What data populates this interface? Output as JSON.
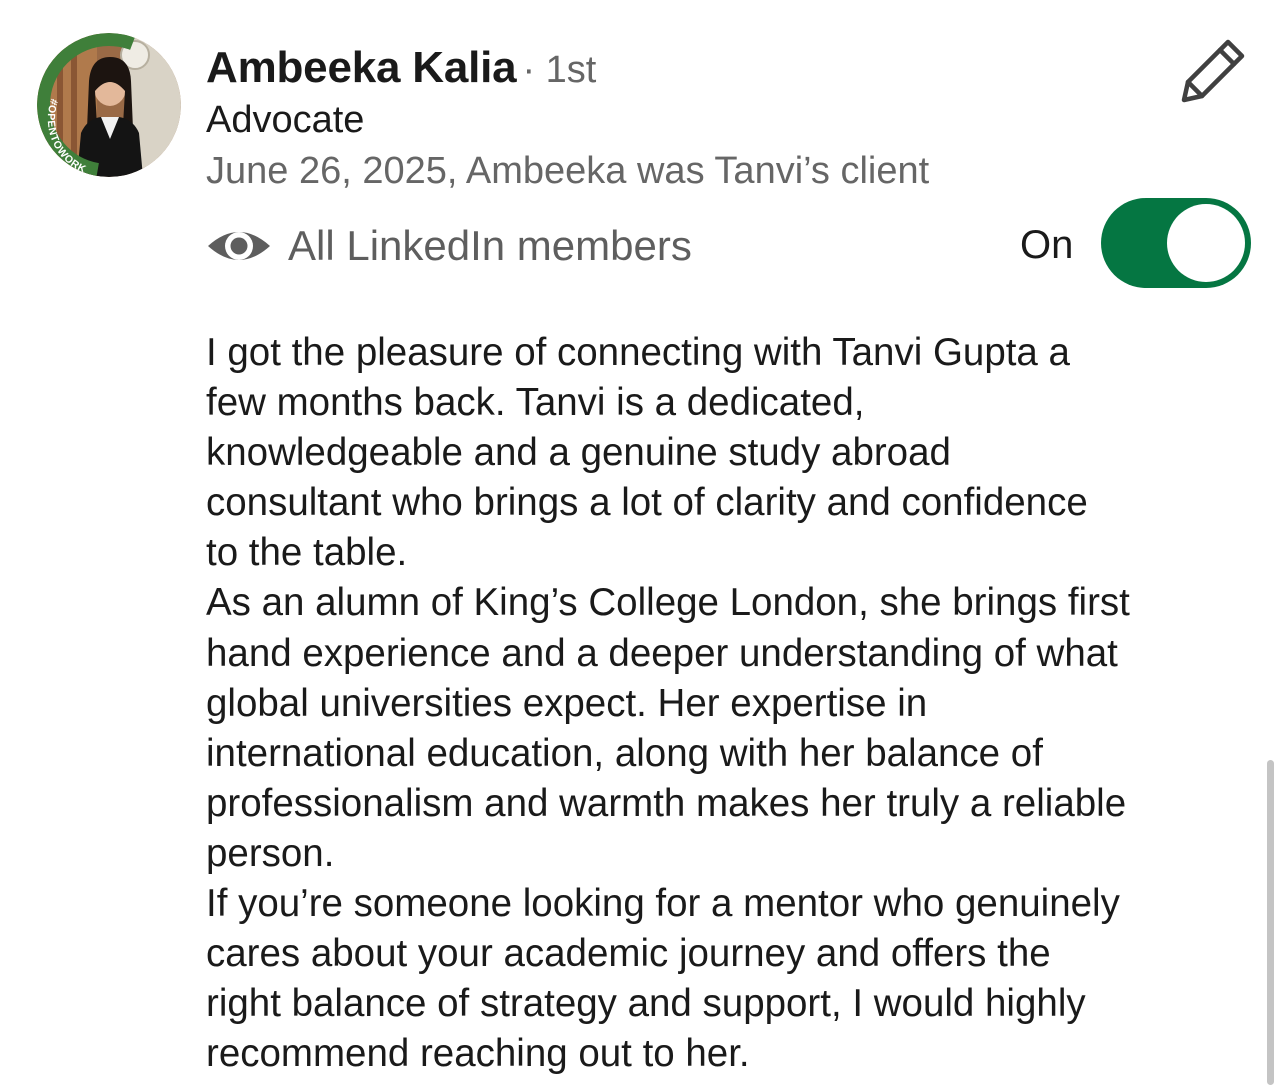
{
  "recommender": {
    "name": "Ambeeka Kalia",
    "connection_degree": "· 1st",
    "headline": "Advocate",
    "relationship": "June 26, 2025, Ambeeka was Tanvi’s client",
    "avatar_badge_text": "#OPENTOWORK"
  },
  "visibility": {
    "icon": "eye-icon",
    "label": "All LinkedIn members",
    "toggle_label": "On",
    "toggle_on": true
  },
  "actions": {
    "edit_icon": "pencil-icon"
  },
  "recommendation": {
    "lines": [
      "I got the pleasure of connecting with Tanvi Gupta a",
      "few months back. Tanvi is a dedicated,",
      "knowledgeable and a genuine study abroad",
      "consultant who brings a lot of clarity and confidence",
      "to the table.",
      "As an alumn of King’s College London, she brings first",
      "hand experience and a deeper understanding of what",
      "global universities expect. Her expertise in",
      "international education, along with her balance of",
      "professionalism and warmth makes her truly a reliable",
      "person.",
      "If you’re someone looking for a mentor who genuinely",
      "cares about your academic journey and offers the",
      "right balance of strategy and support, I would highly",
      "recommend reaching out to her."
    ]
  },
  "colors": {
    "toggle_on": "#057642",
    "open_to_work_ring": "#3f7f3a",
    "secondary_text": "#666666"
  }
}
